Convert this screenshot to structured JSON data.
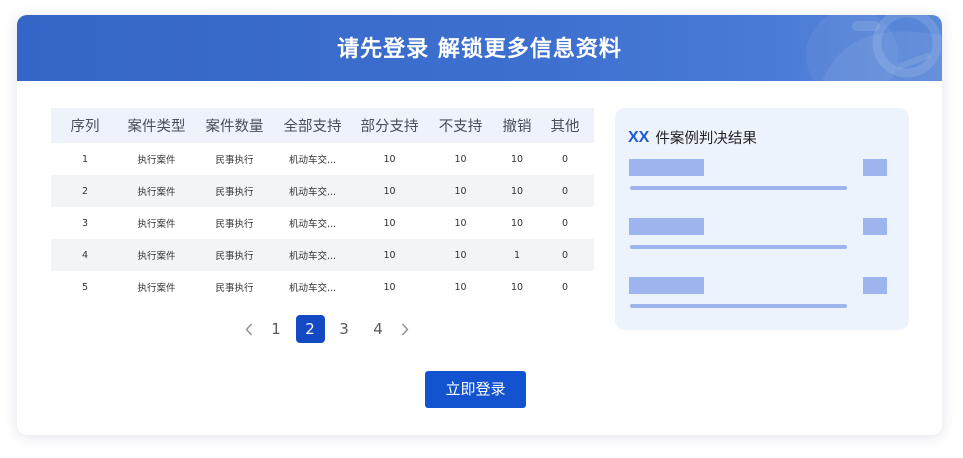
{
  "header": {
    "title": "请先登录 解锁更多信息资料"
  },
  "table": {
    "columns": [
      "序列",
      "案件类型",
      "案件数量",
      "全部支持",
      "部分支持",
      "不支持",
      "撤销",
      "其他"
    ],
    "rows": [
      [
        "1",
        "执行案件",
        "民事执行",
        "机动车交...",
        "10",
        "10",
        "10",
        "0"
      ],
      [
        "2",
        "执行案件",
        "民事执行",
        "机动车交...",
        "10",
        "10",
        "10",
        "0"
      ],
      [
        "3",
        "执行案件",
        "民事执行",
        "机动车交...",
        "10",
        "10",
        "10",
        "0"
      ],
      [
        "4",
        "执行案件",
        "民事执行",
        "机动车交...",
        "10",
        "10",
        "1",
        "0"
      ],
      [
        "5",
        "执行案件",
        "民事执行",
        "机动车交...",
        "10",
        "10",
        "10",
        "0"
      ]
    ]
  },
  "pagination": {
    "pages": [
      "1",
      "2",
      "3",
      "4"
    ],
    "current": "2",
    "prev_icon": "chevron-left-icon",
    "next_icon": "chevron-right-icon"
  },
  "login_button": {
    "label": "立即登录"
  },
  "panel": {
    "title_prefix": "XX",
    "title_text": "件案例判决结果"
  },
  "colors": {
    "header": "#3d6fcf",
    "accent": "#1449c4",
    "button": "#1453d0",
    "panel_bg": "#edf3fd",
    "placeholder": "#9db4ef",
    "table_header_bg": "#eef2fb",
    "row_alt_bg": "#f3f4f6"
  }
}
